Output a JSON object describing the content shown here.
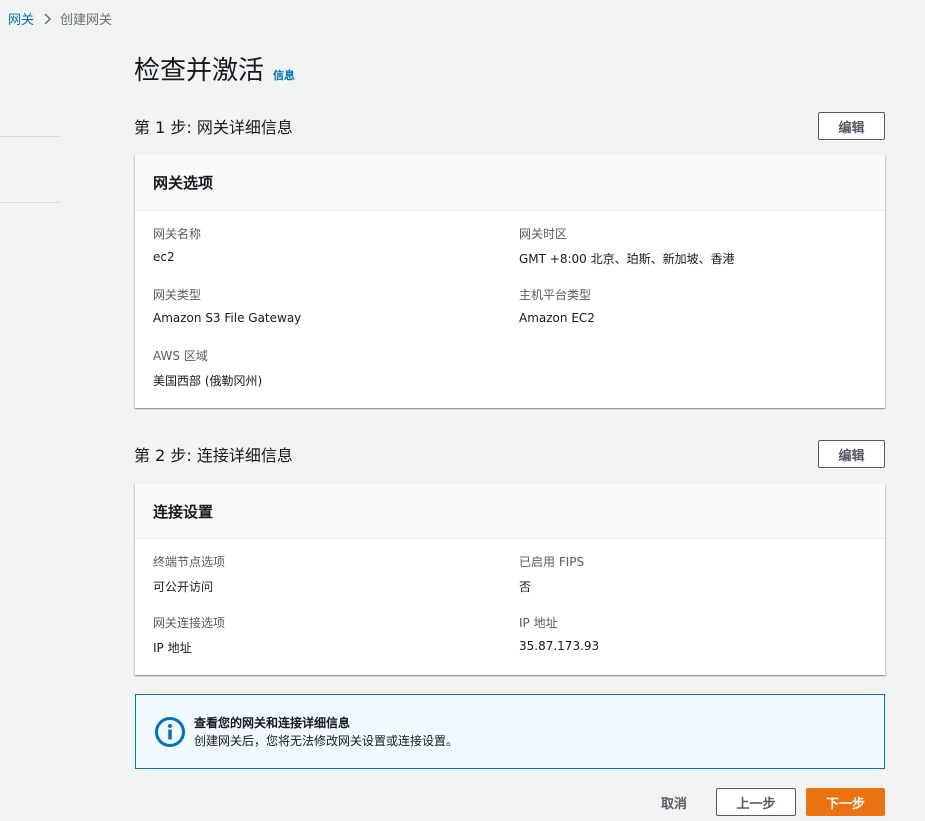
{
  "breadcrumb": {
    "root": "网关",
    "current": "创建网关"
  },
  "page": {
    "title": "检查并激活",
    "info_link": "信息"
  },
  "step1": {
    "title": "第 1 步: 网关详细信息",
    "edit_label": "编辑",
    "panel_title": "网关选项",
    "fields": {
      "gateway_name": {
        "label": "网关名称",
        "value": "ec2"
      },
      "gateway_timezone": {
        "label": "网关时区",
        "value": "GMT +8:00 北京、珀斯、新加坡、香港"
      },
      "gateway_type": {
        "label": "网关类型",
        "value": "Amazon S3 File Gateway"
      },
      "host_platform": {
        "label": "主机平台类型",
        "value": "Amazon EC2"
      },
      "aws_region": {
        "label": "AWS 区域",
        "value": "美国西部 (俄勒冈州)"
      }
    }
  },
  "step2": {
    "title": "第 2 步: 连接详细信息",
    "edit_label": "编辑",
    "panel_title": "连接设置",
    "fields": {
      "endpoint_option": {
        "label": "终端节点选项",
        "value": "可公开访问"
      },
      "fips_enabled": {
        "label": "已启用 FIPS",
        "value": "否"
      },
      "connection_option": {
        "label": "网关连接选项",
        "value": "IP 地址"
      },
      "ip_address": {
        "label": "IP 地址",
        "value": "35.87.173.93"
      }
    }
  },
  "alert": {
    "title": "查看您的网关和连接详细信息",
    "body": "创建网关后，您将无法修改网关设置或连接设置。",
    "icon": "info-icon"
  },
  "footer": {
    "cancel": "取消",
    "previous": "上一步",
    "next": "下一步"
  },
  "colors": {
    "link": "#0073bb",
    "primary": "#ec7211",
    "background": "#f2f3f3"
  }
}
